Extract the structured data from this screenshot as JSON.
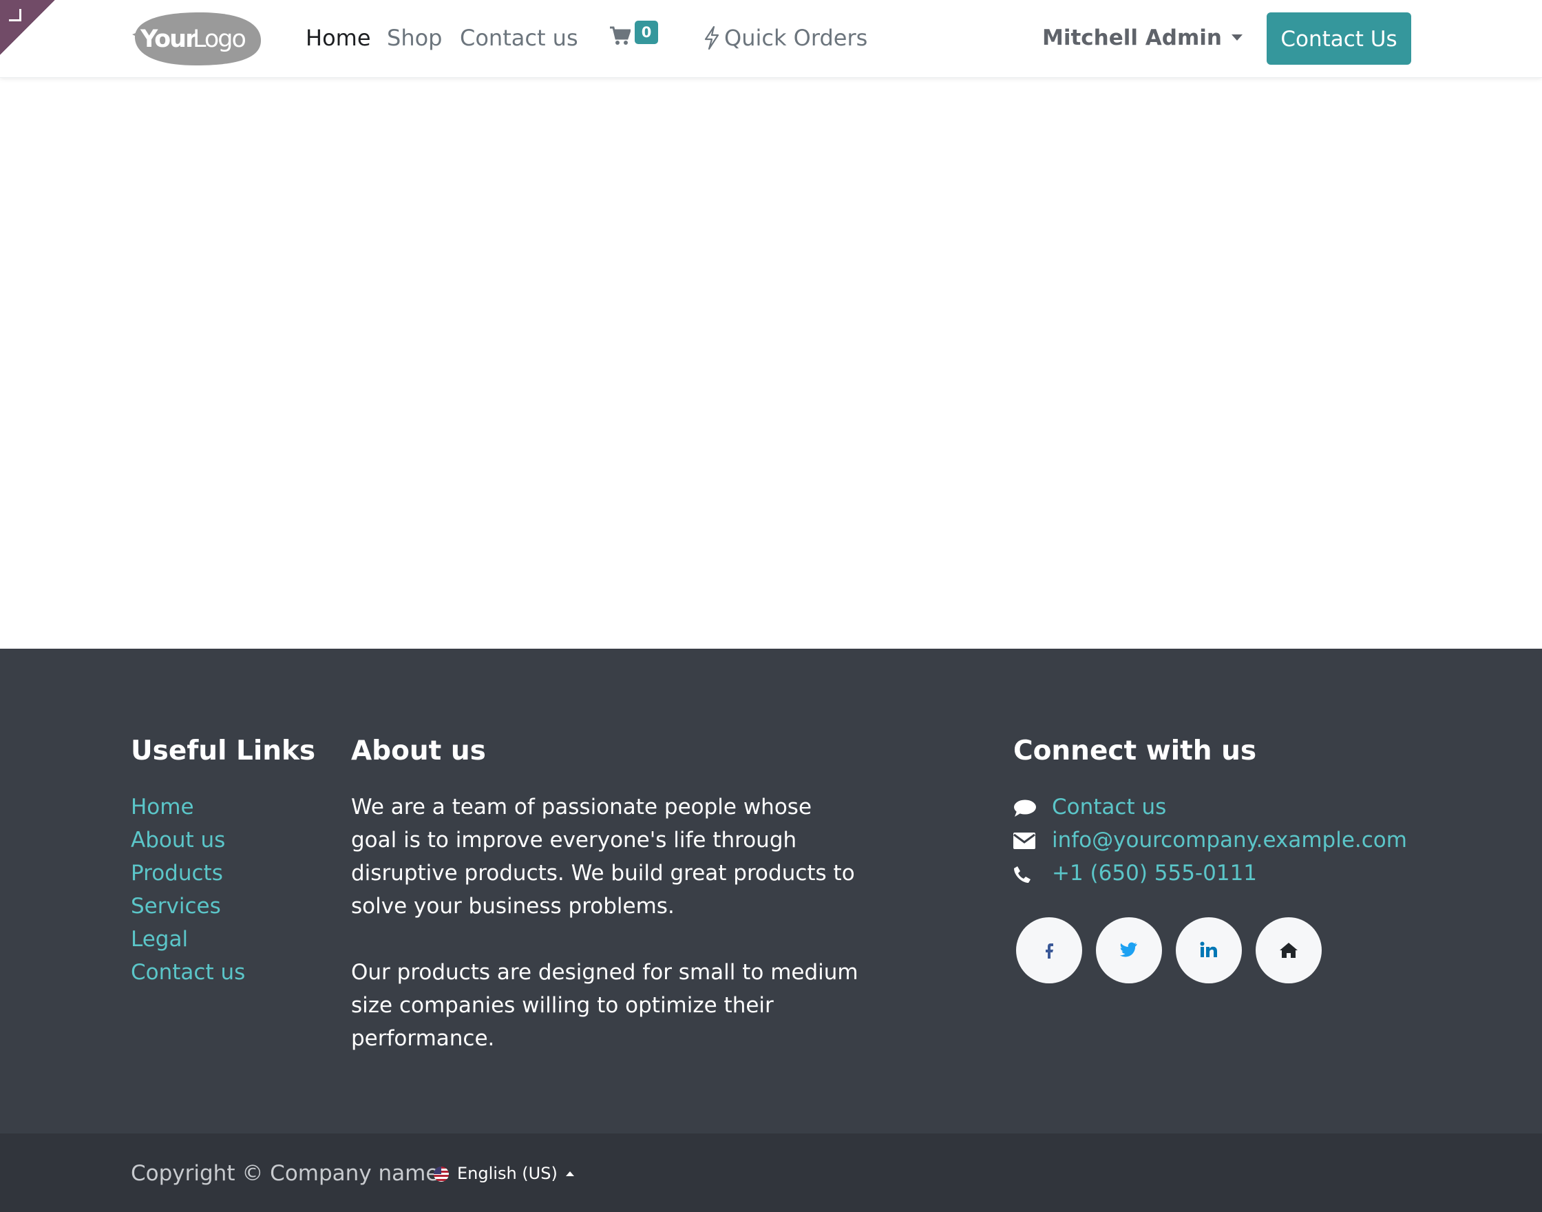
{
  "colors": {
    "accent": "#35979c",
    "link": "#5bc6c9",
    "footer_bg": "#3a3f47",
    "copyright_bg": "#31353c",
    "admin_corner": "#714B67"
  },
  "header": {
    "logo_text": "YourLogo",
    "nav": {
      "home": "Home",
      "shop": "Shop",
      "contact": "Contact us"
    },
    "cart": {
      "icon": "shopping-cart-icon",
      "count": "0"
    },
    "quick_orders": {
      "icon": "bolt-icon",
      "label": "Quick Orders"
    },
    "user": {
      "name": "Mitchell Admin"
    },
    "cta_label": "Contact Us"
  },
  "footer": {
    "useful_links": {
      "title": "Useful Links",
      "items": [
        "Home",
        "About us",
        "Products",
        "Services",
        "Legal",
        "Contact us"
      ]
    },
    "about": {
      "title": "About us",
      "paragraph1": "We are a team of passionate people whose goal is to improve everyone's life through disruptive products. We build great products to solve your business problems.",
      "paragraph2": "Our products are designed for small to medium size companies willing to optimize their performance."
    },
    "connect": {
      "title": "Connect with us",
      "contact_label": "Contact us",
      "email": "info@yourcompany.example.com",
      "phone": "+1 (650) 555-0111",
      "social_icons": [
        "facebook-icon",
        "twitter-icon",
        "linkedin-icon",
        "home-icon"
      ]
    }
  },
  "bottom_bar": {
    "copyright": "Copyright © Company name",
    "language": "English (US)"
  }
}
